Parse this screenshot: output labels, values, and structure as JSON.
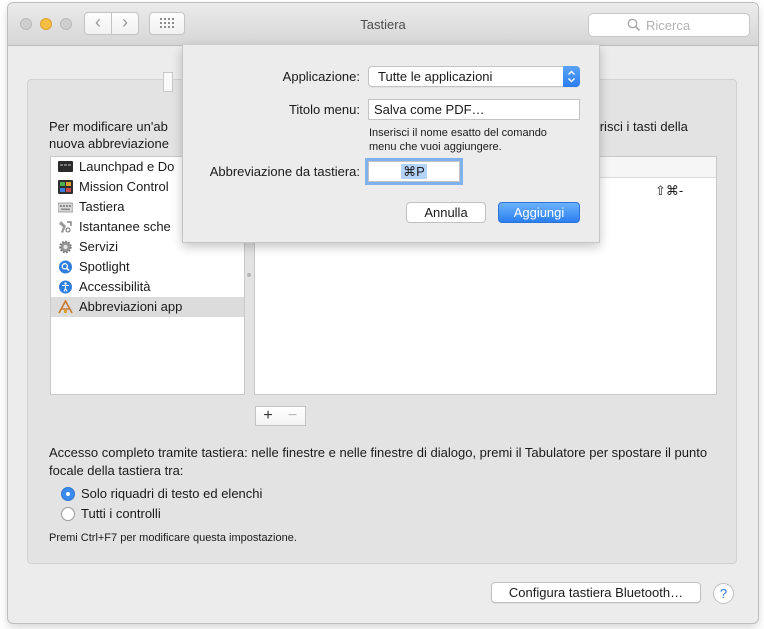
{
  "window": {
    "title": "Tastiera"
  },
  "toolbar": {
    "search_placeholder": "Ricerca"
  },
  "main": {
    "description_line1": "Per modificare un'ab",
    "description_line2": "nuova abbreviazione",
    "description_right": "serisci i tasti della",
    "categories": [
      {
        "label": "Launchpad e Do",
        "icon": "launchpad-icon"
      },
      {
        "label": "Mission Control",
        "icon": "mission-control-icon"
      },
      {
        "label": "Tastiera",
        "icon": "keyboard-icon"
      },
      {
        "label": "Istantanee sche",
        "icon": "screenshot-icon"
      },
      {
        "label": "Servizi",
        "icon": "gear-icon"
      },
      {
        "label": "Spotlight",
        "icon": "spotlight-icon"
      },
      {
        "label": "Accessibilità",
        "icon": "accessibility-icon"
      },
      {
        "label": "Abbreviazioni app",
        "icon": "app-shortcuts-icon",
        "selected": true
      }
    ],
    "shortcut_value": "⇧⌘-",
    "add_label": "+",
    "remove_label": "−",
    "access_text": "Accesso completo tramite tastiera: nelle finestre e nelle finestre di dialogo, premi il Tabulatore per spostare il punto focale della tastiera tra:",
    "radio_options": [
      {
        "label": "Solo riquadri di testo ed elenchi",
        "selected": true
      },
      {
        "label": "Tutti i controlli",
        "selected": false
      }
    ],
    "note": "Premi Ctrl+F7 per modificare questa impostazione.",
    "bluetooth_button": "Configura tastiera Bluetooth…",
    "help_label": "?"
  },
  "sheet": {
    "app_label": "Applicazione:",
    "app_value": "Tutte le applicazioni",
    "menu_title_label": "Titolo menu:",
    "menu_title_value": "Salva come PDF…",
    "hint_line1": "Inserisci il nome esatto del comando",
    "hint_line2": "menu che vuoi aggiungere.",
    "shortcut_label": "Abbreviazione da tastiera:",
    "shortcut_value": "⌘P",
    "cancel_label": "Annulla",
    "add_label": "Aggiungi"
  },
  "colors": {
    "accent": "#2b7ff2",
    "selection": "#dcdcdc"
  }
}
